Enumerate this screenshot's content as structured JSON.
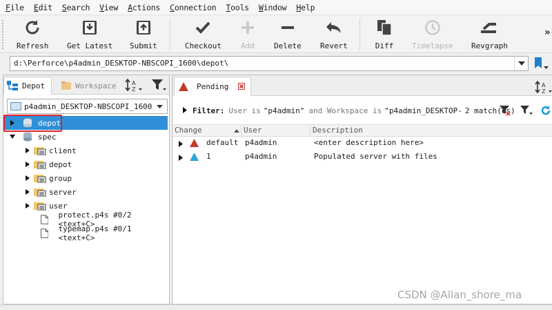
{
  "menu": [
    "File",
    "Edit",
    "Search",
    "View",
    "Actions",
    "Connection",
    "Tools",
    "Window",
    "Help"
  ],
  "toolbar": {
    "refresh": "Refresh",
    "get_latest": "Get Latest",
    "submit": "Submit",
    "checkout": "Checkout",
    "add": "Add",
    "delete": "Delete",
    "revert": "Revert",
    "diff": "Diff",
    "timelapse": "Timelapse",
    "revgraph": "Revgraph",
    "overflow": "»"
  },
  "path": {
    "value": "d:\\Perforce\\p4admin_DESKTOP-NBSCOPI_1600\\depot\\"
  },
  "left": {
    "tab_depot": "Depot",
    "tab_workspace": "Workspace",
    "workspace_select": "p4admin_DESKTOP-NBSCOPI_1600",
    "tree": [
      {
        "label": "depot",
        "selected": true
      },
      {
        "label": "spec"
      },
      {
        "label": "client"
      },
      {
        "label": "depot"
      },
      {
        "label": "group"
      },
      {
        "label": "server"
      },
      {
        "label": "user"
      },
      {
        "label": "protect.p4s #0/2 <text+C>"
      },
      {
        "label": "typemap.p4s #0/1 <text+C>"
      }
    ]
  },
  "right": {
    "tab_pending": "Pending",
    "filter_label": "Filter:",
    "filter_user_prefix": "User is",
    "filter_user_value": "\"p4admin\"",
    "filter_ws_prefix": "and Workspace is",
    "filter_ws_value": "\"p4admin_DESKTOP-",
    "match_count": "2 match(es)",
    "columns": [
      "Change",
      "User",
      "Description"
    ],
    "rows": [
      {
        "change": "default",
        "user": "p4admin",
        "description": "<enter description here>",
        "status_color": "#c0392b"
      },
      {
        "change": "1",
        "user": "p4admin",
        "description": "Populated server with files",
        "status_color": "#2aa7d8"
      }
    ]
  },
  "watermark": "CSDN @Allan_shore_ma",
  "colors": {
    "selection": "#2f8fd8",
    "highlight_box": "#e0242a",
    "accent_blue": "#1e7fd0"
  }
}
